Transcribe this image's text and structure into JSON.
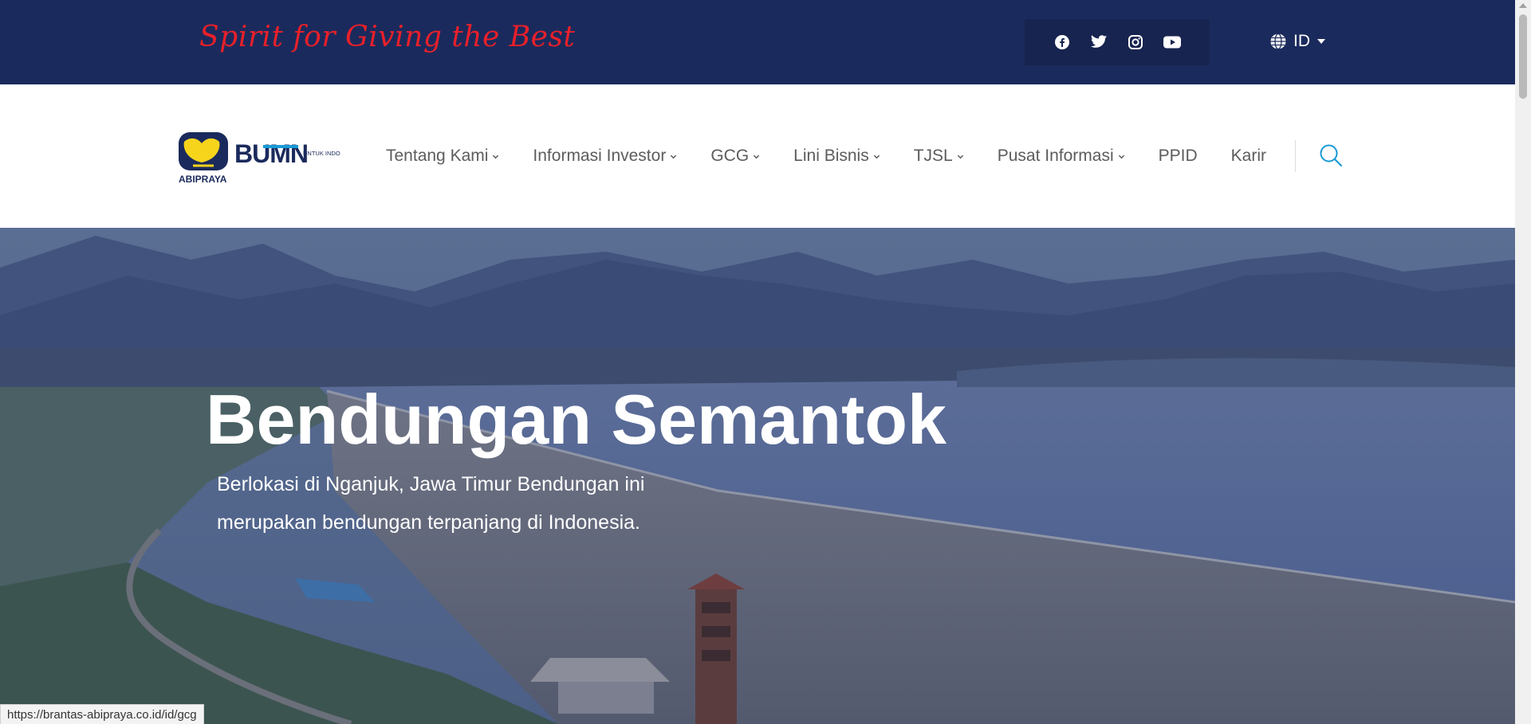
{
  "topbar": {
    "tagline": "Spirit for Giving the Best",
    "social": [
      "facebook-icon",
      "twitter-icon",
      "instagram-icon",
      "youtube-icon"
    ],
    "language": "ID"
  },
  "nav": {
    "logo_text": "ABIPRAYA",
    "bumn_text": "BUMN",
    "bumn_sub": "UNTUK INDONESIA",
    "items": [
      {
        "label": "Tentang Kami",
        "dropdown": true
      },
      {
        "label": "Informasi Investor",
        "dropdown": true
      },
      {
        "label": "GCG",
        "dropdown": true
      },
      {
        "label": "Lini Bisnis",
        "dropdown": true
      },
      {
        "label": "TJSL",
        "dropdown": true
      },
      {
        "label": "Pusat Informasi",
        "dropdown": true
      },
      {
        "label": "PPID",
        "dropdown": false
      },
      {
        "label": "Karir",
        "dropdown": false
      }
    ]
  },
  "hero": {
    "title": "Bendungan Semantok",
    "description": "Berlokasi di Nganjuk, Jawa Timur Bendungan ini merupakan bendungan terpanjang di Indonesia."
  },
  "status_url": "https://brantas-abipraya.co.id/id/gcg",
  "colors": {
    "topbar": "#1b2a5c",
    "tagline": "#e8202a",
    "nav_text": "#5c5c5c",
    "accent": "#1a9ad6"
  }
}
